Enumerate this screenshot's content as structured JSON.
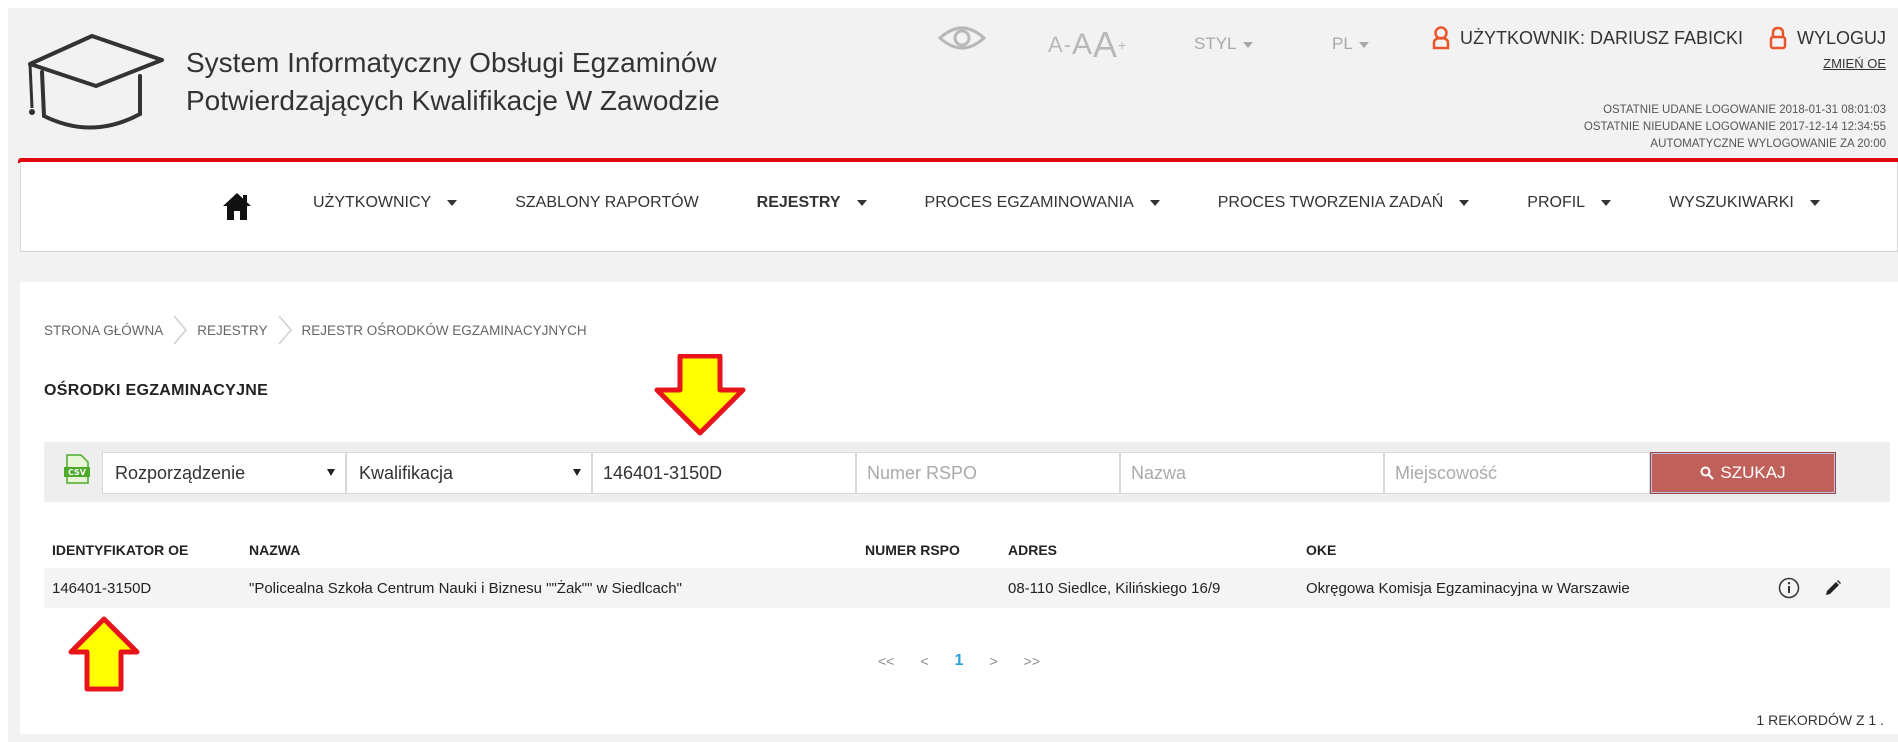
{
  "header": {
    "title_line1": "System Informatyczny Obsługi Egzaminów",
    "title_line2": "Potwierdzających Kwalifikacje W Zawodzie",
    "style_label": "STYL",
    "lang_label": "PL",
    "font_small": "A-",
    "font_normal": "A",
    "font_large": "A",
    "font_plus": "+",
    "user_label": "UŻYTKOWNIK: DARIUSZ FABICKI",
    "logout_label": "WYLOGUJ",
    "change_label": "ZMIEŃ OE",
    "last_success": "OSTATNIE UDANE LOGOWANIE 2018-01-31 08:01:03",
    "last_fail": "OSTATNIE NIEUDANE LOGOWANIE 2017-12-14 12:34:55",
    "auto_logout": "AUTOMATYCZNE WYLOGOWANIE ZA  20:00"
  },
  "nav": {
    "items": [
      {
        "label": "UŻYTKOWNICY"
      },
      {
        "label": "SZABLONY RAPORTÓW"
      },
      {
        "label": "REJESTRY"
      },
      {
        "label": "PROCES EGZAMINOWANIA"
      },
      {
        "label": "PROCES TWORZENIA ZADAŃ"
      },
      {
        "label": "PROFIL"
      },
      {
        "label": "WYSZUKIWARKI"
      }
    ]
  },
  "breadcrumb": {
    "items": [
      "STRONA GŁÓWNA",
      "REJESTRY",
      "REJESTR OŚRODKÓW EGZAMINACYJNYCH"
    ]
  },
  "page": {
    "title": "OŚRODKI EGZAMINACYJNE"
  },
  "search": {
    "rozporzadzenie": "Rozporządzenie",
    "kwalifikacja": "Kwalifikacja",
    "id_value": "146401-3150D",
    "rspo_placeholder": "Numer RSPO",
    "nazwa_placeholder": "Nazwa",
    "miejscowosc_placeholder": "Miejscowość",
    "search_label": "SZUKAJ"
  },
  "table": {
    "headers": [
      "IDENTYFIKATOR OE",
      "NAZWA",
      "NUMER RSPO",
      "ADRES",
      "OKE"
    ],
    "rows": [
      {
        "id": "146401-3150D",
        "name": "\"Policealna Szkoła Centrum Nauki i Biznesu \"\"Żak\"\" w Siedlcach\"",
        "rspo": "",
        "address": "08-110 Siedlce, Kilińskiego 16/9",
        "oke": "Okręgowa Komisja Egzaminacyjna w Warszawie"
      }
    ]
  },
  "pager": {
    "first": "<<",
    "prev": "<",
    "current": "1",
    "next": ">",
    "last": ">>"
  },
  "records": "1  REKORDÓW Z  1  .",
  "colors": {
    "accent_red": "#e20613",
    "search_button": "#c0605a",
    "arrow_fill": "#ffff00",
    "arrow_stroke": "#e8141c",
    "pager_active": "#2b9fd8"
  }
}
